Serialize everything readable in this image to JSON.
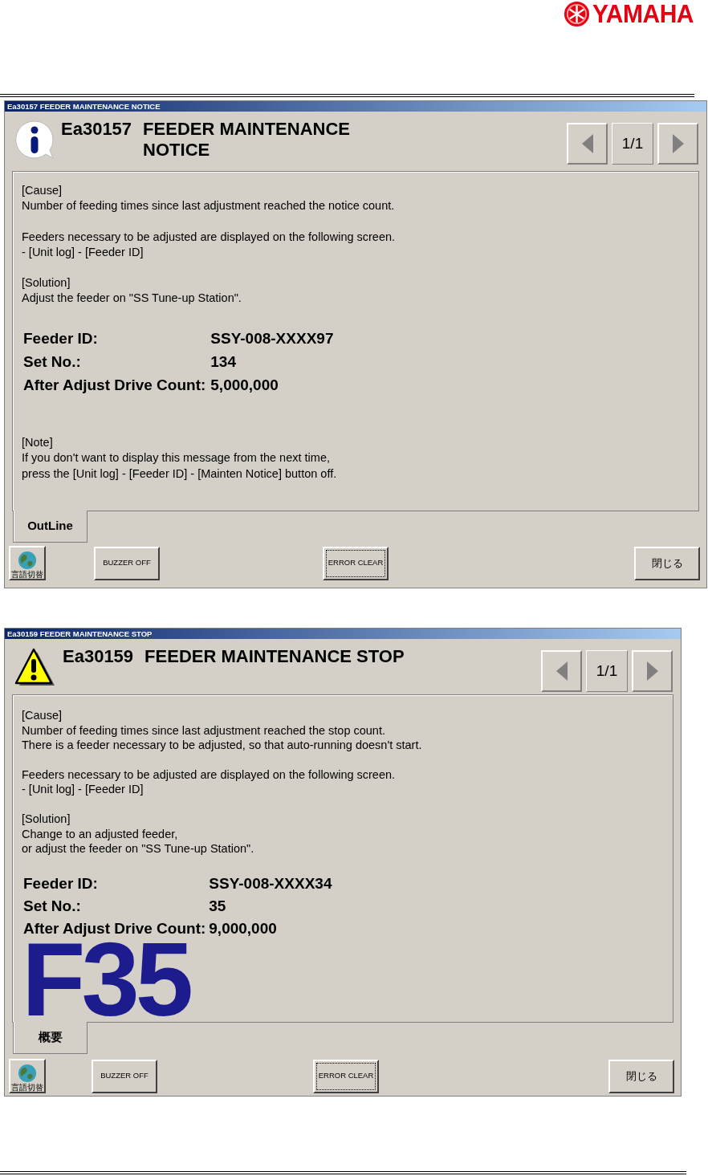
{
  "header": {
    "logo": "YAMAHA"
  },
  "dialogs": [
    {
      "window_title": "Ea30157 FEEDER MAINTENANCE NOTICE",
      "kind": "info",
      "code": "Ea30157",
      "title_lines": [
        "FEEDER MAINTENANCE",
        "NOTICE"
      ],
      "page": "1/1",
      "message": [
        [
          "[Cause]",
          "Number of feeding times since last adjustment reached the notice count."
        ],
        [
          "Feeders necessary to be adjusted are displayed on the following screen.",
          "- [Unit log] - [Feeder ID]"
        ],
        [
          "[Solution]",
          "Adjust the feeder on \"SS Tune-up Station\"."
        ]
      ],
      "fields": [
        {
          "label": "Feeder ID:",
          "value": "SSY-008-XXXX97"
        },
        {
          "label": "Set No.:",
          "value": "134"
        },
        {
          "label": "After Adjust Drive Count:",
          "value": "5,000,000"
        }
      ],
      "note": [
        "[Note]",
        "If you don't want to display this message from the next time,",
        "press the  [Unit log] - [Feeder ID] - [Mainten Notice] button off."
      ],
      "tab": {
        "label": "OutLine",
        "selected": true
      },
      "buttons": {
        "language": "言語切替",
        "buzzer": "BUZZER OFF",
        "error_clear": "ERROR CLEAR",
        "close": "閉じる"
      }
    },
    {
      "window_title": "Ea30159 FEEDER MAINTENANCE STOP",
      "kind": "warning",
      "code": "Ea30159",
      "title_lines": [
        "FEEDER MAINTENANCE STOP"
      ],
      "page": "1/1",
      "message": [
        [
          "[Cause]",
          "Number of feeding times since last adjustment reached the stop count.",
          "There is a feeder necessary to be adjusted, so that auto-running doesn't start."
        ],
        [
          "Feeders necessary to be adjusted are displayed on the following screen.",
          "- [Unit log] - [Feeder ID]"
        ],
        [
          "[Solution]",
          "Change to an adjusted feeder,",
          "or adjust the feeder on \"SS Tune-up Station\"."
        ]
      ],
      "fields": [
        {
          "label": "Feeder ID:",
          "value": "SSY-008-XXXX34"
        },
        {
          "label": "Set No.:",
          "value": "35"
        },
        {
          "label": "After Adjust Drive Count:",
          "value": "9,000,000"
        }
      ],
      "big_label": "F35",
      "tab": {
        "label": "概要",
        "selected": true
      },
      "buttons": {
        "language": "言語切替",
        "buzzer": "BUZZER OFF",
        "error_clear": "ERROR CLEAR",
        "close": "閉じる"
      }
    }
  ]
}
